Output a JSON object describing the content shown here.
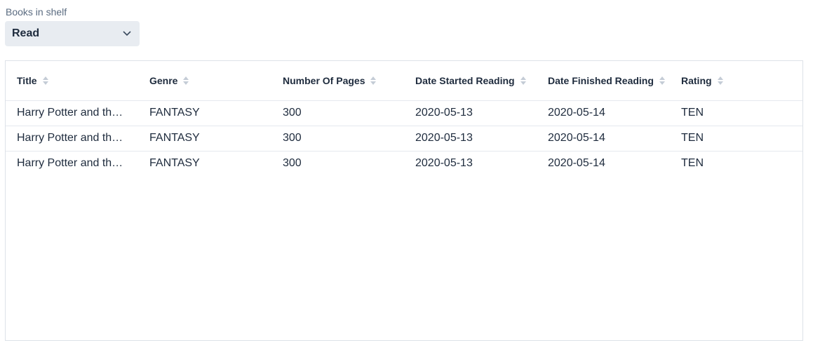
{
  "shelf": {
    "label": "Books in shelf",
    "selected": "Read"
  },
  "table": {
    "columns": [
      {
        "label": "Title"
      },
      {
        "label": "Genre"
      },
      {
        "label": "Number Of Pages"
      },
      {
        "label": "Date Started Reading"
      },
      {
        "label": "Date Finished Reading"
      },
      {
        "label": "Rating"
      }
    ],
    "rows": [
      [
        "Harry Potter and the…",
        "FANTASY",
        "300",
        "2020-05-13",
        "2020-05-14",
        "TEN"
      ],
      [
        "Harry Potter and the…",
        "FANTASY",
        "300",
        "2020-05-13",
        "2020-05-14",
        "TEN"
      ],
      [
        "Harry Potter and the…",
        "FANTASY",
        "300",
        "2020-05-13",
        "2020-05-14",
        "TEN"
      ]
    ]
  },
  "icons": {
    "dropdown": "chevron-down-icon",
    "sort": "sort-icon"
  }
}
